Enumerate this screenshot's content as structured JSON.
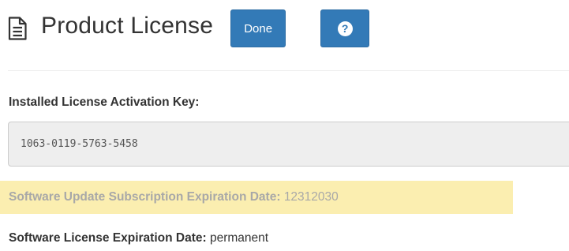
{
  "header": {
    "title": "Product License",
    "done_label": "Done",
    "help_glyph": "?",
    "title_icon": "document-icon",
    "help_icon": "question-circle-icon"
  },
  "license": {
    "key_label": "Installed License Activation Key:",
    "key_value": "1063-0119-5763-5458",
    "subscription_label": "Software Update Subscription Expiration Date:",
    "subscription_value": "12312030",
    "license_label": "Software License Expiration Date:",
    "license_value": "permanent"
  },
  "colors": {
    "primary_button": "#337ab7",
    "highlight": "#fbeeb0",
    "muted_text": "#a8a8a8",
    "field_background": "#eeeeee"
  }
}
